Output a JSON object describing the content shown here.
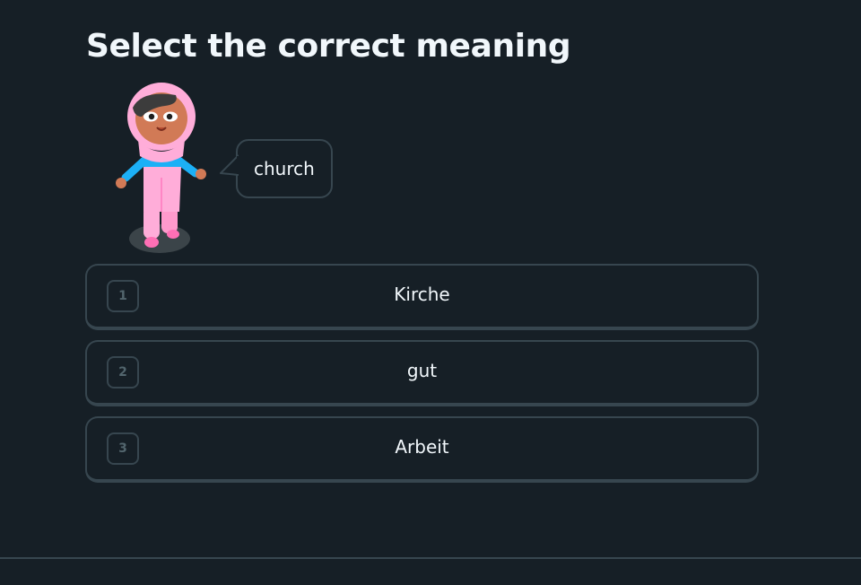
{
  "challenge": {
    "title": "Select the correct meaning"
  },
  "prompt": {
    "word": "church",
    "character": "woman-hijab-character-icon"
  },
  "options": [
    {
      "number": "1",
      "label": "Kirche"
    },
    {
      "number": "2",
      "label": "gut"
    },
    {
      "number": "3",
      "label": "Arbeit"
    }
  ],
  "colors": {
    "background": "#161f26",
    "border": "#37464f",
    "text": "#f1f7fb",
    "number": "#52656d"
  }
}
